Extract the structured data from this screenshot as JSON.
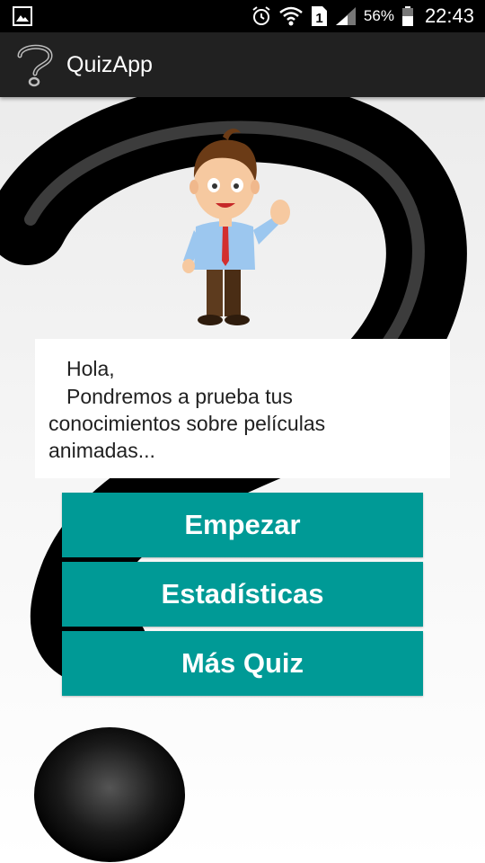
{
  "status_bar": {
    "battery_percent": "56%",
    "clock": "22:43",
    "sim_slot": "1",
    "icons": [
      "image-notification-icon",
      "alarm-icon",
      "wifi-icon",
      "sim-icon",
      "signal-icon",
      "battery-icon"
    ]
  },
  "app_bar": {
    "title": "QuizApp",
    "logo_icon": "question-mark-icon"
  },
  "intro": {
    "greeting": "Hola,",
    "line1": "Pondremos a prueba tus",
    "line2": "conocimientos sobre películas",
    "line3": "animadas..."
  },
  "buttons": {
    "start": "Empezar",
    "stats": "Estadísticas",
    "more": "Más Quiz"
  },
  "colors": {
    "accent": "#009a96",
    "app_bar": "#212121",
    "status_bar": "#000000"
  }
}
